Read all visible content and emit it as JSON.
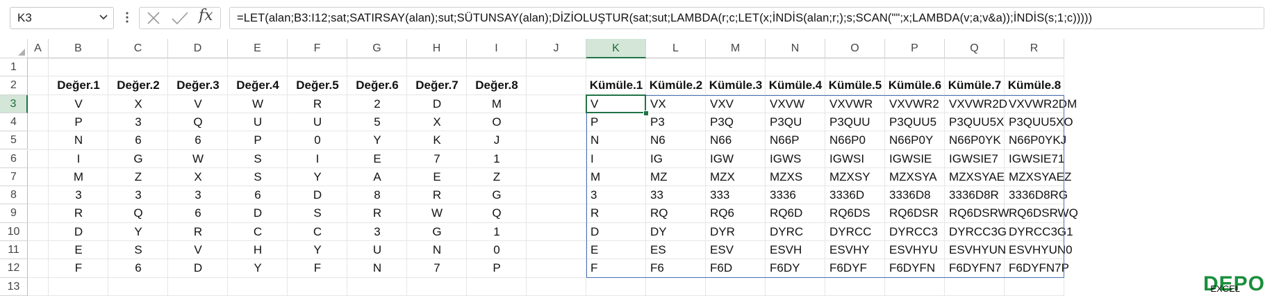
{
  "formula_bar": {
    "name_box": "K3",
    "function_icon": "fx-icon",
    "formula": "=LET(alan;B3:I12;sat;SATIRSAY(alan);sut;SÜTUNSAY(alan);DİZİOLUŞTUR(sat;sut;LAMBDA(r;c;LET(x;İNDİS(alan;r;);s;SCAN(\"\";x;LAMBDA(v;a;v&a));İNDİS(s;1;c)))))"
  },
  "sheet": {
    "selected_cell": "K3",
    "columns": [
      "A",
      "B",
      "C",
      "D",
      "E",
      "F",
      "G",
      "H",
      "I",
      "J",
      "K",
      "L",
      "M",
      "N",
      "O",
      "P",
      "Q",
      "R"
    ],
    "rows": [
      "1",
      "2",
      "3",
      "4",
      "5",
      "6",
      "7",
      "8",
      "9",
      "10",
      "11",
      "12",
      "13"
    ],
    "value_headers": [
      "Değer.1",
      "Değer.2",
      "Değer.3",
      "Değer.4",
      "Değer.5",
      "Değer.6",
      "Değer.7",
      "Değer.8"
    ],
    "values": [
      [
        "V",
        "X",
        "V",
        "W",
        "R",
        "2",
        "D",
        "M"
      ],
      [
        "P",
        "3",
        "Q",
        "U",
        "U",
        "5",
        "X",
        "O"
      ],
      [
        "N",
        "6",
        "6",
        "P",
        "0",
        "Y",
        "K",
        "J"
      ],
      [
        "I",
        "G",
        "W",
        "S",
        "I",
        "E",
        "7",
        "1"
      ],
      [
        "M",
        "Z",
        "X",
        "S",
        "Y",
        "A",
        "E",
        "Z"
      ],
      [
        "3",
        "3",
        "3",
        "6",
        "D",
        "8",
        "R",
        "G"
      ],
      [
        "R",
        "Q",
        "6",
        "D",
        "S",
        "R",
        "W",
        "Q"
      ],
      [
        "D",
        "Y",
        "R",
        "C",
        "C",
        "3",
        "G",
        "1"
      ],
      [
        "E",
        "S",
        "V",
        "H",
        "Y",
        "U",
        "N",
        "0"
      ],
      [
        "F",
        "6",
        "D",
        "Y",
        "F",
        "N",
        "7",
        "P"
      ]
    ],
    "cumulative_headers": [
      "Kümüle.1",
      "Kümüle.2",
      "Kümüle.3",
      "Kümüle.4",
      "Kümüle.5",
      "Kümüle.6",
      "Kümüle.7",
      "Kümüle.8"
    ],
    "cumulative": [
      [
        "V",
        "VX",
        "VXV",
        "VXVW",
        "VXVWR",
        "VXVWR2",
        "VXVWR2D",
        "VXVWR2DM"
      ],
      [
        "P",
        "P3",
        "P3Q",
        "P3QU",
        "P3QUU",
        "P3QUU5",
        "P3QUU5X",
        "P3QUU5XO"
      ],
      [
        "N",
        "N6",
        "N66",
        "N66P",
        "N66P0",
        "N66P0Y",
        "N66P0YK",
        "N66P0YKJ"
      ],
      [
        "I",
        "IG",
        "IGW",
        "IGWS",
        "IGWSI",
        "IGWSIE",
        "IGWSIE7",
        "IGWSIE71"
      ],
      [
        "M",
        "MZ",
        "MZX",
        "MZXS",
        "MZXSY",
        "MZXSYA",
        "MZXSYAE",
        "MZXSYAEZ"
      ],
      [
        "3",
        "33",
        "333",
        "3336",
        "3336D",
        "3336D8",
        "3336D8R",
        "3336D8RG"
      ],
      [
        "R",
        "RQ",
        "RQ6",
        "RQ6D",
        "RQ6DS",
        "RQ6DSR",
        "RQ6DSRW",
        "RQ6DSRWQ"
      ],
      [
        "D",
        "DY",
        "DYR",
        "DYRC",
        "DYRCC",
        "DYRCC3",
        "DYRCC3G",
        "DYRCC3G1"
      ],
      [
        "E",
        "ES",
        "ESV",
        "ESVH",
        "ESVHY",
        "ESVHYU",
        "ESVHYUN",
        "ESVHYUN0"
      ],
      [
        "F",
        "F6",
        "F6D",
        "F6DY",
        "F6DYF",
        "F6DYFN",
        "F6DYFN7",
        "F6DYFN7P"
      ]
    ]
  },
  "watermark": {
    "logo_text": "DEPO",
    "logo_sub": "EXCEL"
  },
  "colors": {
    "accent": "#217346",
    "spill_border": "#4a72b8"
  }
}
